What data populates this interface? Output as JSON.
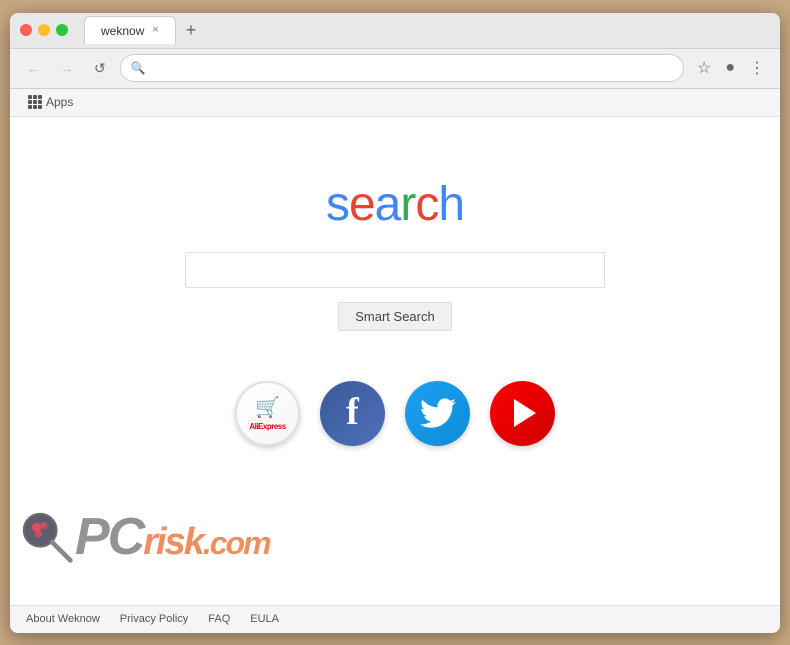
{
  "browser": {
    "title": "weknow",
    "tab_label": "weknow",
    "new_tab_symbol": "+",
    "close_symbol": "×"
  },
  "nav": {
    "back_label": "←",
    "forward_label": "→",
    "reload_label": "↺",
    "address_placeholder": "",
    "star_symbol": "☆",
    "profile_symbol": "●",
    "menu_symbol": "⋮"
  },
  "bookmarks": {
    "apps_label": "Apps"
  },
  "page": {
    "logo_letters": [
      "s",
      "e",
      "a",
      "r",
      "c",
      "h"
    ],
    "search_button_label": "Smart Search",
    "search_placeholder": ""
  },
  "social": [
    {
      "id": "aliexpress",
      "label": "AliExpress"
    },
    {
      "id": "facebook",
      "label": "Facebook"
    },
    {
      "id": "twitter",
      "label": "Twitter"
    },
    {
      "id": "youtube",
      "label": "YouTube"
    }
  ],
  "footer": {
    "links": [
      "About Weknow",
      "Privacy Policy",
      "FAQ",
      "EULA"
    ]
  },
  "watermark": {
    "pc": "PC",
    "risk": "risk",
    "dot_com": ".com"
  }
}
